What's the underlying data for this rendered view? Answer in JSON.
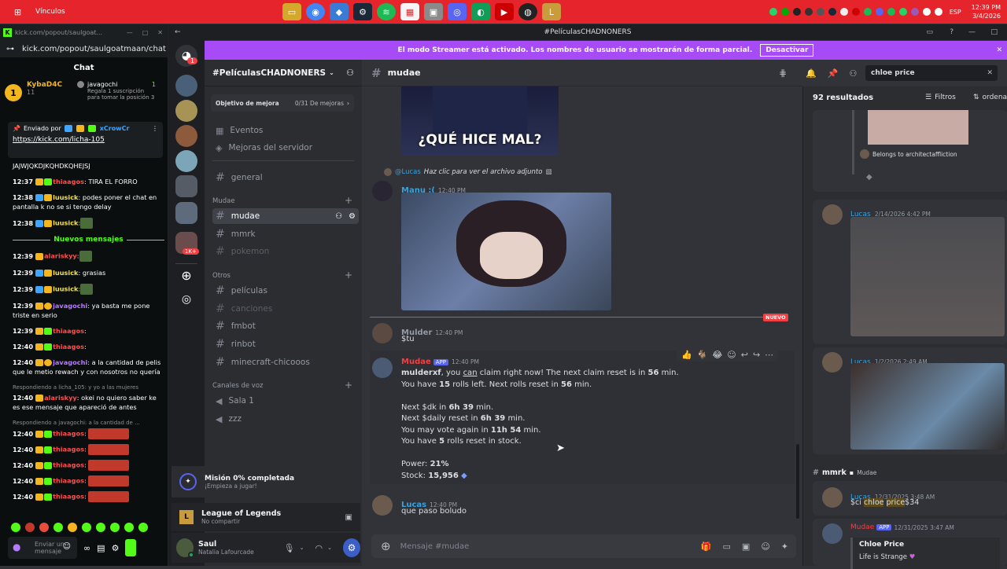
{
  "taskbar": {
    "title": "Vínculos",
    "lang": "ESP",
    "time": "12:39 PM",
    "date": "3/4/2026"
  },
  "kick": {
    "url_dim": "kick.com/popout/saulgoat...",
    "url": "kick.com/popout/saulgoatmaan/chat",
    "chat_title": "Chat",
    "sub_user": "KybaD4C",
    "sub_count": "11",
    "gift_user": "javagochi",
    "gift_count": "1",
    "gift_desc": "Regala 1 suscripción para tomar la posición 3",
    "pinned_by": "Enviado por",
    "pinned_user": "xCrowCr",
    "pinned_link": "https://kick.com/licha-105",
    "messages": [
      {
        "time": "",
        "user": "",
        "color": "#fff",
        "text": "JAJWJQKDJKQHDKQHEJSJ"
      },
      {
        "time": "12:37",
        "user": "thiaagos",
        "color": "#ff4d4d",
        "text": ": TIRA EL FORRO"
      },
      {
        "time": "12:38",
        "user": "luusick",
        "color": "#f5e342",
        "text": ": podes poner el chat en pantalla k no se si tengo delay"
      },
      {
        "time": "12:38",
        "user": "luusick",
        "color": "#f5e342",
        "text": ":"
      }
    ],
    "new_sep": "Nuevos mensajes",
    "messages2": [
      {
        "time": "12:39",
        "user": "alariskyy",
        "color": "#ff4d4d",
        "text": ":"
      },
      {
        "time": "12:39",
        "user": "luusick",
        "color": "#f5e342",
        "text": ": grasias"
      },
      {
        "time": "12:39",
        "user": "luusick",
        "color": "#f5e342",
        "text": ":"
      },
      {
        "time": "12:39",
        "user": "javagochi",
        "color": "#b57bff",
        "text": ": ya basta me pone triste en serio"
      },
      {
        "time": "12:39",
        "user": "thiaagos",
        "color": "#ff4d4d",
        "text": ":"
      },
      {
        "time": "12:40",
        "user": "thiaagos",
        "color": "#ff4d4d",
        "text": ":"
      },
      {
        "time": "12:40",
        "user": "javagochi",
        "color": "#b57bff",
        "text": ": a la cantidad de pelis que le metio rewach y con nosotros no quería"
      }
    ],
    "reply1": "Respondiendo a licha_105: y yo a las mujeres",
    "msg_reply1": {
      "time": "12:40",
      "user": "alariskyy",
      "color": "#ff4d4d",
      "text": ": okei no quiero saber ke es ese mensaje que apareció de antes"
    },
    "reply2": "Respondiendo a javagochi: a la cantidad de ...",
    "spam": [
      {
        "time": "12:40",
        "user": "thiaagos"
      },
      {
        "time": "12:40",
        "user": "thiaagos"
      },
      {
        "time": "12:40",
        "user": "thiaagos"
      },
      {
        "time": "12:40",
        "user": "thiaagos"
      },
      {
        "time": "12:40",
        "user": "thiaagos"
      }
    ],
    "send_placeholder": "Enviar un mensaje"
  },
  "discord": {
    "window_title": "#PelículasCHADNONERS",
    "guild_badge": "1",
    "guild_badge2": "1K+",
    "streamer_banner": "El modo Streamer está activado. Los nombres de usuario se mostrarán de forma parcial.",
    "streamer_button": "Desactivar",
    "server_name": "#PelículasCHADNONERS",
    "boost_label": "Objetivo de mejora",
    "boost_progress": "0/31 De mejoras",
    "events": "Eventos",
    "server_boosts": "Mejoras del servidor",
    "channels": {
      "general": "general",
      "cat_mudae": "Mudae",
      "mudae": "mudae",
      "mmrk": "mmrk",
      "pokemon": "pokemon",
      "cat_otros": "Otros",
      "peliculas": "películas",
      "canciones": "canciones",
      "fmbot": "fmbot",
      "rinbot": "rinbot",
      "minecraft": "minecraft-chicooos",
      "cat_voz": "Canales de voz",
      "sala1": "Sala 1",
      "zzz": "zzz"
    },
    "mission_title": "Misión 0% completada",
    "mission_sub": "¡Empieza a jugar!",
    "game_title": "League of Legends",
    "game_sub": "No compartir",
    "user_name": "Saul",
    "user_status": "Natalia Lafourcade",
    "channel_header": "mudae",
    "image_caption": "¿QUÉ HICE MAL?",
    "reply_user": "@Lucas",
    "reply_text": "Haz clic para ver el archivo adjunto",
    "msg1": {
      "user": "Manu :(",
      "time": "12:40 PM"
    },
    "new_label": "NUEVO",
    "msg2": {
      "user": "Mulder",
      "time": "12:40 PM",
      "text": "$tu"
    },
    "msg3": {
      "user": "Mudae",
      "app": "APP",
      "time": "12:40 PM",
      "line1a": "mulderxf",
      "line1b": ", you ",
      "line1c": "can",
      "line1d": " claim right now! The next claim reset is in ",
      "line1e": "56",
      "line1f": " min.",
      "line2a": "You have ",
      "line2b": "15",
      "line2c": " rolls left. Next rolls reset in ",
      "line2d": "56",
      "line2e": " min.",
      "line3a": "Next $dk in ",
      "line3b": "6h 39",
      "line3c": " min.",
      "line4a": "Next $daily reset in ",
      "line4b": "6h 39",
      "line4c": " min.",
      "line5a": "You may vote again in ",
      "line5b": "11h 54",
      "line5c": " min.",
      "line6a": "You have ",
      "line6b": "5",
      "line6c": " rolls reset in stock.",
      "power_a": "Power: ",
      "power_b": "21%",
      "stock_a": "Stock: ",
      "stock_b": "15,956"
    },
    "msg4": {
      "user": "Lucas",
      "time": "12:40 PM",
      "text": "que paso boludo"
    },
    "composer_placeholder": "Mensaje #mudae",
    "search_value": "chloe price",
    "results_count": "92 resultados",
    "filters": "Filtros",
    "sort": "ordenar",
    "r_belongs": "Belongs to architectaffliction",
    "r1": {
      "user": "Lucas",
      "time": "2/14/2026 4:42 PM"
    },
    "r2": {
      "user": "Lucas",
      "time": "1/2/2026 2:49 AM"
    },
    "r_channel": "mmrk",
    "r_category": "Mudae",
    "r3": {
      "user": "Lucas",
      "time": "12/31/2025 3:48 AM",
      "t1": "$ci ",
      "t2": "chloe",
      "t3": " ",
      "t4": "price",
      "t5": "$34"
    },
    "r4": {
      "user": "Mudae",
      "app": "APP",
      "time": "12/31/2025 3:47 AM",
      "embed_title": "Chloe Price",
      "embed_line": "Life is Strange"
    }
  }
}
